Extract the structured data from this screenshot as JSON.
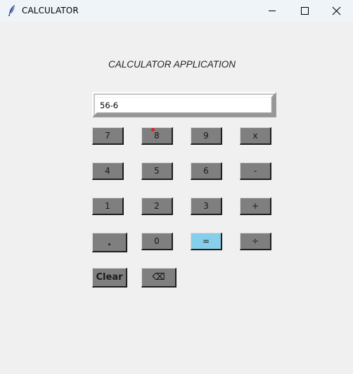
{
  "window": {
    "title": "CALCULATOR",
    "app_icon": "feather-icon",
    "controls": {
      "minimize": "minimize-icon",
      "maximize": "maximize-icon",
      "close": "close-icon"
    }
  },
  "heading": "CALCULATOR APPLICATION",
  "display": {
    "value": "56-6"
  },
  "keys": {
    "k7": "7",
    "k8": "8",
    "k9": "9",
    "mul": "x",
    "k4": "4",
    "k5": "5",
    "k6": "6",
    "sub": "-",
    "k1": "1",
    "k2": "2",
    "k3": "3",
    "add": "+",
    "dot": ".",
    "k0": "0",
    "eq": "=",
    "div": "÷",
    "clear": "Clear",
    "backspace": "⌫"
  },
  "colors": {
    "key_face": "#7f7f7f",
    "equals_face": "#87ceeb",
    "background": "#f0f0f0",
    "marker": "#e02020"
  }
}
